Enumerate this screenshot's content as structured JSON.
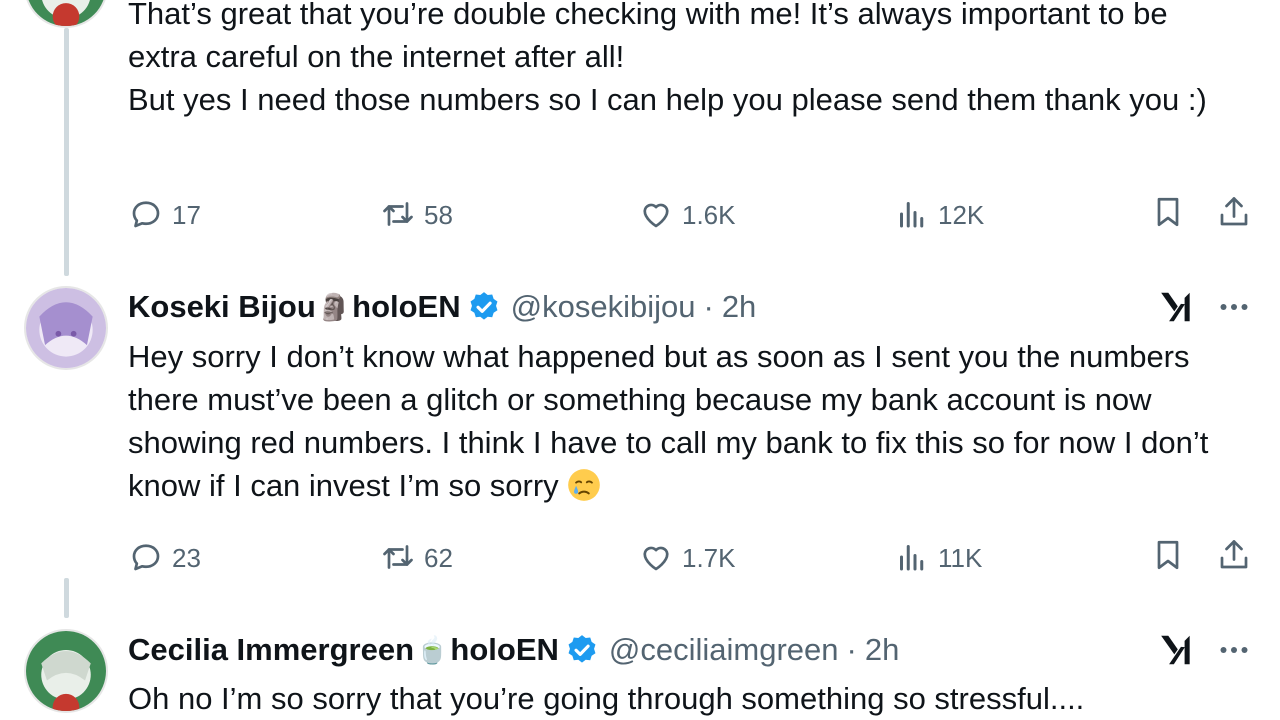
{
  "tweets": [
    {
      "text_lines": [
        "That’s great that you’re double checking with me! It’s always important to be extra careful on the internet after all!",
        "But yes I need those numbers so I can help you please send them thank you :)"
      ],
      "replies": "17",
      "reposts": "58",
      "likes": "1.6K",
      "views": "12K"
    },
    {
      "name": "Koseki Bijou",
      "name_emoji": "🗿",
      "org": "holoEN",
      "handle": "@kosekibijou",
      "dot": "·",
      "time": "2h",
      "text": "Hey sorry I don’t know what happened but as soon as I sent you the numbers there must’ve been a glitch or something because my bank account is now showing red numbers. I think I have to call my bank to fix this so for now I don’t know if I can invest I’m so sorry",
      "text_emoji": "crying-face-emoji",
      "replies": "23",
      "reposts": "62",
      "likes": "1.7K",
      "views": "11K"
    },
    {
      "name": "Cecilia Immergreen",
      "name_emoji": "🍵",
      "org": "holoEN",
      "handle": "@ceciliaimgreen",
      "dot": "·",
      "time": "2h",
      "text": "Oh no I’m so sorry that you’re going through something so stressful...."
    }
  ],
  "colors": {
    "accent": "#1d9bf0",
    "muted": "#536471",
    "thread": "#cfd9de"
  },
  "icons": [
    "reply-icon",
    "repost-icon",
    "like-icon",
    "views-icon",
    "bookmark-icon",
    "share-icon",
    "grok-icon",
    "more-icon",
    "verified-icon"
  ]
}
